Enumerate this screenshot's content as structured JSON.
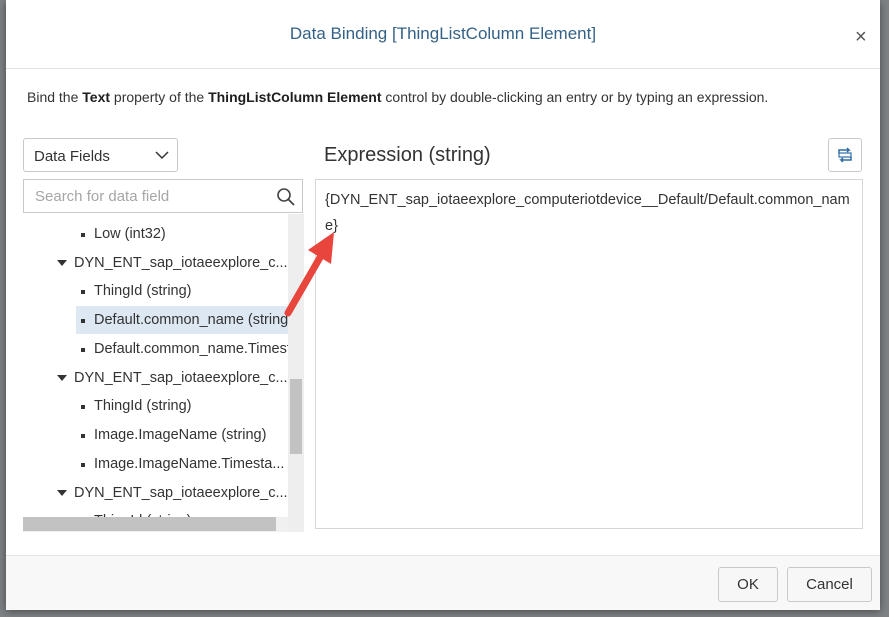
{
  "dialog": {
    "title": "Data Binding [ThingListColumn Element]",
    "close_glyph": "×"
  },
  "description": {
    "prefix": "Bind the ",
    "property": "Text",
    "middle": " property of the ",
    "control": "ThingListColumn Element",
    "suffix": " control by double-clicking an entry or by typing an expression."
  },
  "left_panel": {
    "select_value": "Data Fields",
    "search_placeholder": "Search for data field",
    "tree": [
      {
        "type": "leaf",
        "label": "Low (int32)"
      },
      {
        "type": "group",
        "label": "DYN_ENT_sap_iotaeexplore_c..."
      },
      {
        "type": "leaf",
        "label": "ThingId (string)"
      },
      {
        "type": "leaf",
        "label": "Default.common_name (string)",
        "selected": true
      },
      {
        "type": "leaf",
        "label": "Default.common_name.Timestamp"
      },
      {
        "type": "group",
        "label": "DYN_ENT_sap_iotaeexplore_c..."
      },
      {
        "type": "leaf",
        "label": "ThingId (string)"
      },
      {
        "type": "leaf",
        "label": "Image.ImageName (string)"
      },
      {
        "type": "leaf",
        "label": "Image.ImageName.Timesta..."
      },
      {
        "type": "group",
        "label": "DYN_ENT_sap_iotaeexplore_c..."
      },
      {
        "type": "leaf",
        "label": "ThingId (string)"
      }
    ]
  },
  "right_panel": {
    "expression_title": "Expression (string)",
    "expression_value": "{DYN_ENT_sap_iotaeexplore_computeriotdevice__Default/Default.common_name}"
  },
  "footer": {
    "ok_label": "OK",
    "cancel_label": "Cancel"
  },
  "colors": {
    "title": "#346187",
    "selection": "#dde8f3",
    "arrow": "#e8453c"
  },
  "icons": [
    "chevron-down-icon",
    "search-icon",
    "refresh-icon",
    "close-icon",
    "annotation-arrow"
  ]
}
